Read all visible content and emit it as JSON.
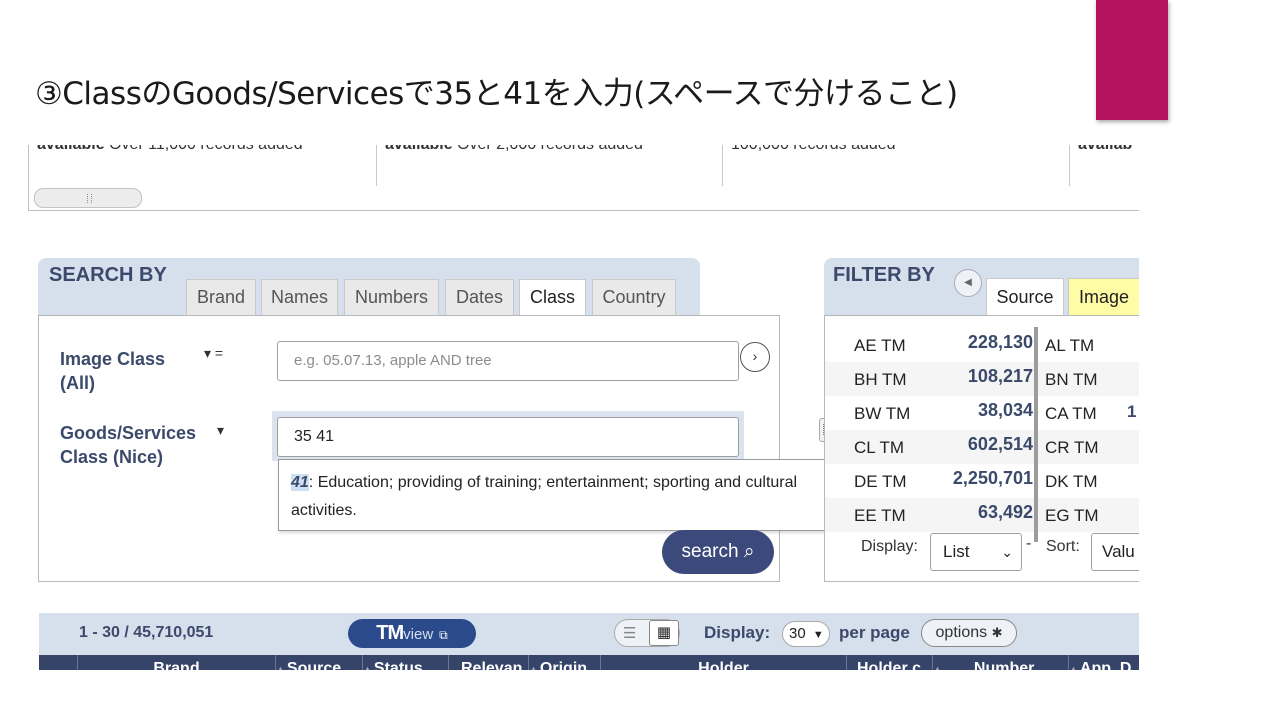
{
  "slide": {
    "title": "③ClassのGoods/Servicesで35と41を入力(スペースで分けること)",
    "accent_color": "#b5135f"
  },
  "records": [
    {
      "bold": "available",
      "text": "Over 11,000 records added"
    },
    {
      "bold": "available",
      "text": "Over 2,000 records added"
    },
    {
      "bold": "",
      "text": "100,000 records added"
    },
    {
      "bold": "availab",
      "text": ""
    }
  ],
  "search_by": {
    "title": "SEARCH BY",
    "tabs": [
      "Brand",
      "Names",
      "Numbers",
      "Dates",
      "Class",
      "Country"
    ],
    "active_tab": "Class",
    "image_class": {
      "label_line1": "Image Class",
      "label_line2": "(All)",
      "operator": "▾ =",
      "placeholder": "e.g. 05.07.13, apple AND tree"
    },
    "goods_services": {
      "label_line1": "Goods/Services",
      "label_line2": "Class (Nice)",
      "operator": "▾",
      "value": "35 41"
    },
    "suggestion": {
      "code": "41",
      "text": ": Education; providing of training; entertainment; sporting and cultural activities."
    },
    "search_button": "search ⌕"
  },
  "filter_by": {
    "title": "FILTER BY",
    "tabs": [
      "Source",
      "Image"
    ],
    "active_tab": "Source",
    "rows": [
      {
        "code": "AE TM",
        "count": "228,130",
        "code2": "AL TM",
        "extra": ""
      },
      {
        "code": "BH TM",
        "count": "108,217",
        "code2": "BN TM",
        "extra": ""
      },
      {
        "code": "BW TM",
        "count": "38,034",
        "code2": "CA TM",
        "extra": "1"
      },
      {
        "code": "CL TM",
        "count": "602,514",
        "code2": "CR TM",
        "extra": ""
      },
      {
        "code": "DE TM",
        "count": "2,250,701",
        "code2": "DK TM",
        "extra": ""
      },
      {
        "code": "EE TM",
        "count": "63,492",
        "code2": "EG TM",
        "extra": ""
      }
    ],
    "display_label": "Display:",
    "display_value": "List",
    "sort_label": "Sort:",
    "sort_value": "Valu",
    "dash": "-"
  },
  "results": {
    "count": "1 - 30 / 45,710,051",
    "tmview": {
      "tm": "TM",
      "view": "view"
    },
    "display_label": "Display:",
    "per_page_value": "30",
    "per_page_label": "per page",
    "options_label": "options"
  },
  "table_headers": [
    "",
    "Brand",
    "Source",
    "Status",
    "Relevan",
    "Origin",
    "Holder",
    "Holder c",
    "Number",
    "App. D"
  ]
}
